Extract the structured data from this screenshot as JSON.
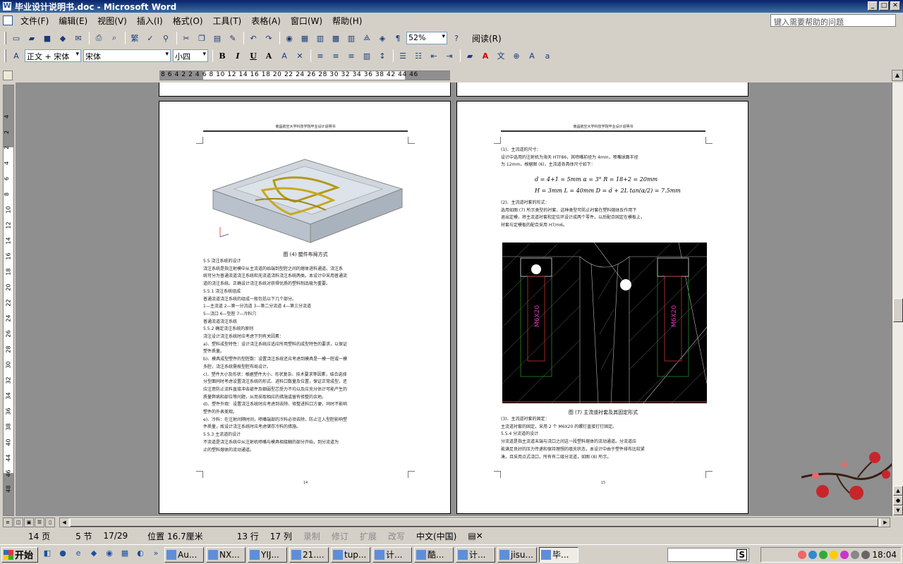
{
  "window": {
    "title": "毕业设计说明书.doc - Microsoft Word",
    "minimize": "_",
    "maximize": "□",
    "close": "✕"
  },
  "menu": [
    "文件(F)",
    "编辑(E)",
    "视图(V)",
    "插入(I)",
    "格式(O)",
    "工具(T)",
    "表格(A)",
    "窗口(W)",
    "帮助(H)"
  ],
  "help_box": {
    "placeholder": "键入需要帮助的问题"
  },
  "toolbar": {
    "zoom": "52%",
    "read_label": "阅读(R)",
    "traditional": "繁"
  },
  "format_bar": {
    "style": "正文 + 宋体",
    "font": "宋体",
    "size": "小四",
    "bold": "B",
    "italic": "I",
    "underline": "U",
    "char_border": "A"
  },
  "ruler": {
    "numbers": "8  6  4  2      2  4  6  8  10 12 14 16 18 20 22 24 26 28 30 32 34 36 38     42 44 46"
  },
  "vruler": [
    "4",
    "2",
    "2",
    "4",
    "6",
    "8",
    "10",
    "12",
    "14",
    "16",
    "18",
    "20",
    "22",
    "24",
    "26",
    "28",
    "30",
    "32",
    "34",
    "36",
    "38",
    "40",
    "44",
    "46",
    "48"
  ],
  "page_left": {
    "header": "南昌航空大学科技学院毕业设计说明书",
    "fig_caption": "图 (4) 塑件布局方式",
    "lines": [
      "5.5 浇注系统的设计",
      "    浇注系统是指注射模中从主流道的始端到型腔之间的熔体进料通道。浇注系",
      "统可分为普通流道浇注系统和无流道浇料浇注系统两类。本设计中采用普通流",
      "道的浇注系统。正确设计浇注系统对获得优质的塑料制品极为重要。",
      "5.5.1 浇注系统组成",
      "    普通流道浇注系统的组成一般包括以下几个部分。",
      "",
      "   1—主流道  2—第一分流道  3—第二分流道  4—第三分流道",
      "              5—浇口    6—型腔    7—冷料穴",
      "                        普通流道浇注系统",
      "5.5.2 确定浇注系统的原则",
      "浇注设计浇注系统时应考虑下列有关因素：",
      "a)、塑料成型特性：设计浇注系统应适应所用塑料的成型特性的要求，以保证",
      "塑件质量。",
      "b)、模具成型塑件的型腔数：设置浇注系统还应考虑到模具是一模一腔或一模",
      "多腔，浇注系统需按型腔布局设计。",
      "c)、塑件大小及形状：根据塑件大小、形状复杂、技术要求等因素，结合选择",
      "分型面同时考虑设置浇注系统的形式、进料口数量及位置，保证正常成型，还",
      "应注意防止流料直接冲击嵌件及细弱型芯受力不均以及应充分估计可能产生的",
      "质量弊病和部位等问题，从而采取相应的措施或留有修整的余地。",
      "d)、塑件外观：设置浇注系统时应考虑到去除、修整进料口方便，同时不影响",
      "塑件的外表美观。",
      "e)、冷料：在注射间隔时间，喷嘴端部的冷料必须去除，防止注入型腔影响塑",
      "件质量，故设计浇注系统时应考虑储存冷料的措施。",
      "5.5.3 主流道的设计",
      "    不流道是浇注系统中从注射机喷嘴与模具相接触的部分开始，到分流道为",
      "止的塑料熔体的流动通道。"
    ],
    "page_no": "14"
  },
  "page_right": {
    "header": "南昌航空大学科技学院毕业设计说明书",
    "lines_top": [
      "(1)、主流道的尺寸：",
      "    设计中选用的注射机为海天 HTF86，其喷嘴前径为 4mm，喷嘴球面半径",
      "为 12mm，根据图 (6)，主流道各具体尺寸如下：",
      "",
      "",
      "",
      "",
      "(2)、主流道衬套的形式：",
      "    选用如图 (7) 所示类型的衬套，这种类型可防止衬套在塑料熔体反作用下",
      "退出定模，将主流道衬套和定位环设计成两个零件，以后配合固定在模板上，",
      "衬套与定模板的配合采用 H7/m6。"
    ],
    "formula1": "d = 4+1 = 5mm        α = 3°        R = 18+2 = 20mm",
    "formula2": "H = 3mm          L = 40mm        D = d + 2L tan(α/2) = 7.5mm",
    "fig_caption": "图 (7) 主流道衬套及其固定形式",
    "lines_bottom": [
      "(3)、主流道衬套的固定：",
      "    主流道衬套的固定，采用 2 个 M6X20 的螺钉直接钉钉固定。",
      "5.5.4 分流道的设计",
      "    分流道是指主流道末端与浇口之间这一段塑料熔体的流动通道。分流道应",
      "能满足良好的压力传递和保持理想的填充状态，本设计中由于塑件排布比较紧",
      "凑，且采用点式浇口，所有有二级分流道，如图 (8) 所示。"
    ],
    "page_no": "15"
  },
  "status": {
    "page": "14 页",
    "section": "5 节",
    "pages": "17/29",
    "position": "位置 16.7厘米",
    "line": "13 行",
    "col": "17 列",
    "rec": "录制",
    "trk": "修订",
    "ext": "扩展",
    "ovr": "改写",
    "lang": "中文(中国)"
  },
  "taskbar": {
    "start": "开始",
    "tasks": [
      "Au...",
      "NX...",
      "YIJ...",
      "21....",
      "tup...",
      "计...",
      "酷...",
      "计...",
      "jisu...",
      "毕..."
    ],
    "search_label": "S",
    "clock": "18:04"
  }
}
